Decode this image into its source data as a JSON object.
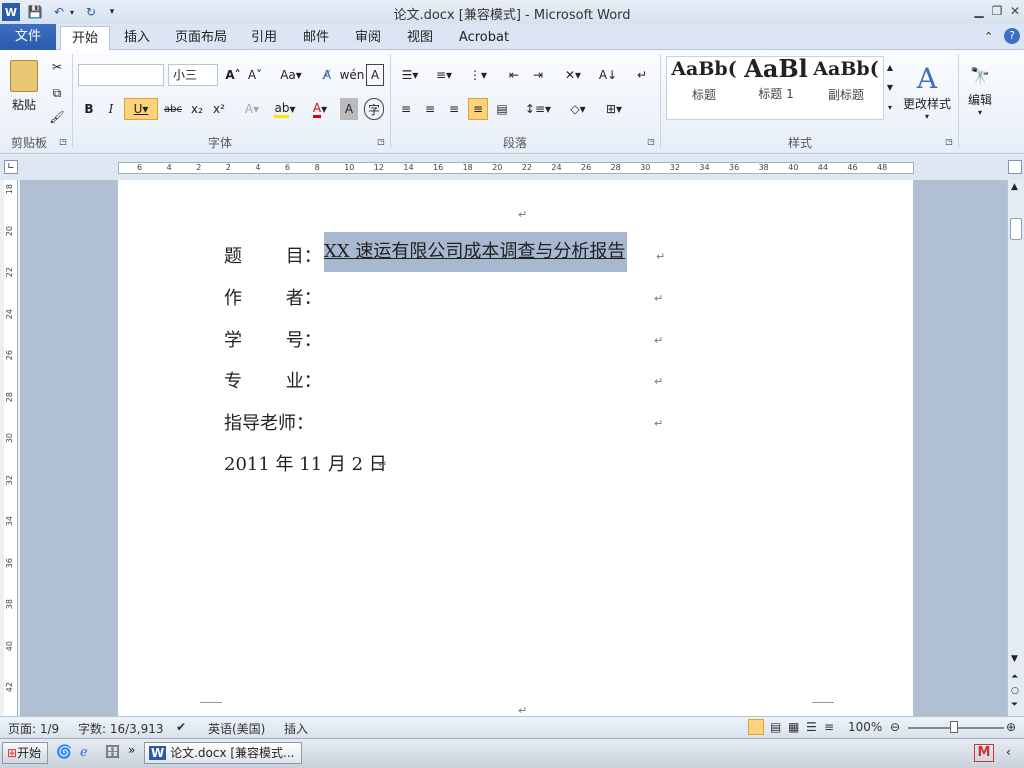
{
  "window": {
    "title": "论文.docx [兼容模式] - Microsoft Word"
  },
  "tabs": [
    "开始",
    "插入",
    "页面布局",
    "引用",
    "邮件",
    "审阅",
    "视图",
    "Acrobat"
  ],
  "file_tab": "文件",
  "ribbon": {
    "clipboard": {
      "label": "剪贴板",
      "paste": "粘贴"
    },
    "font": {
      "label": "字体",
      "size": "小三"
    },
    "paragraph": {
      "label": "段落"
    },
    "styles": {
      "label": "样式",
      "items": [
        {
          "preview": "AaBb(",
          "name": "标题"
        },
        {
          "preview": "AaBl",
          "name": "标题 1"
        },
        {
          "preview": "AaBb(",
          "name": "副标题"
        }
      ],
      "change": "更改样式"
    },
    "edit": {
      "label": "编辑"
    }
  },
  "ruler": {
    "h_ticks": [
      "6",
      "4",
      "2",
      "2",
      "4",
      "6",
      "8",
      "10",
      "12",
      "14",
      "16",
      "18",
      "20",
      "22",
      "24",
      "26",
      "28",
      "30",
      "32",
      "34",
      "36",
      "38",
      "40",
      "44",
      "46",
      "48"
    ],
    "v_ticks": [
      "18",
      "20",
      "22",
      "24",
      "26",
      "28",
      "30",
      "32",
      "34",
      "36",
      "38",
      "40",
      "42"
    ]
  },
  "document": {
    "title_label": "题 目：",
    "title_value": "XX 速运有限公司成本调查与分析报告",
    "author_label": "作 者：",
    "student_no_label": "学 号：",
    "major_label": "专 业：",
    "advisor_label": "指导老师：",
    "date": "2011 年 11 月 2 日"
  },
  "status": {
    "page": "页面: 1/9",
    "words": "字数: 16/3,913",
    "language": "英语(美国)",
    "mode": "插入",
    "zoom": "100%"
  },
  "taskbar": {
    "start": "开始",
    "task": "论文.docx [兼容模式..."
  }
}
